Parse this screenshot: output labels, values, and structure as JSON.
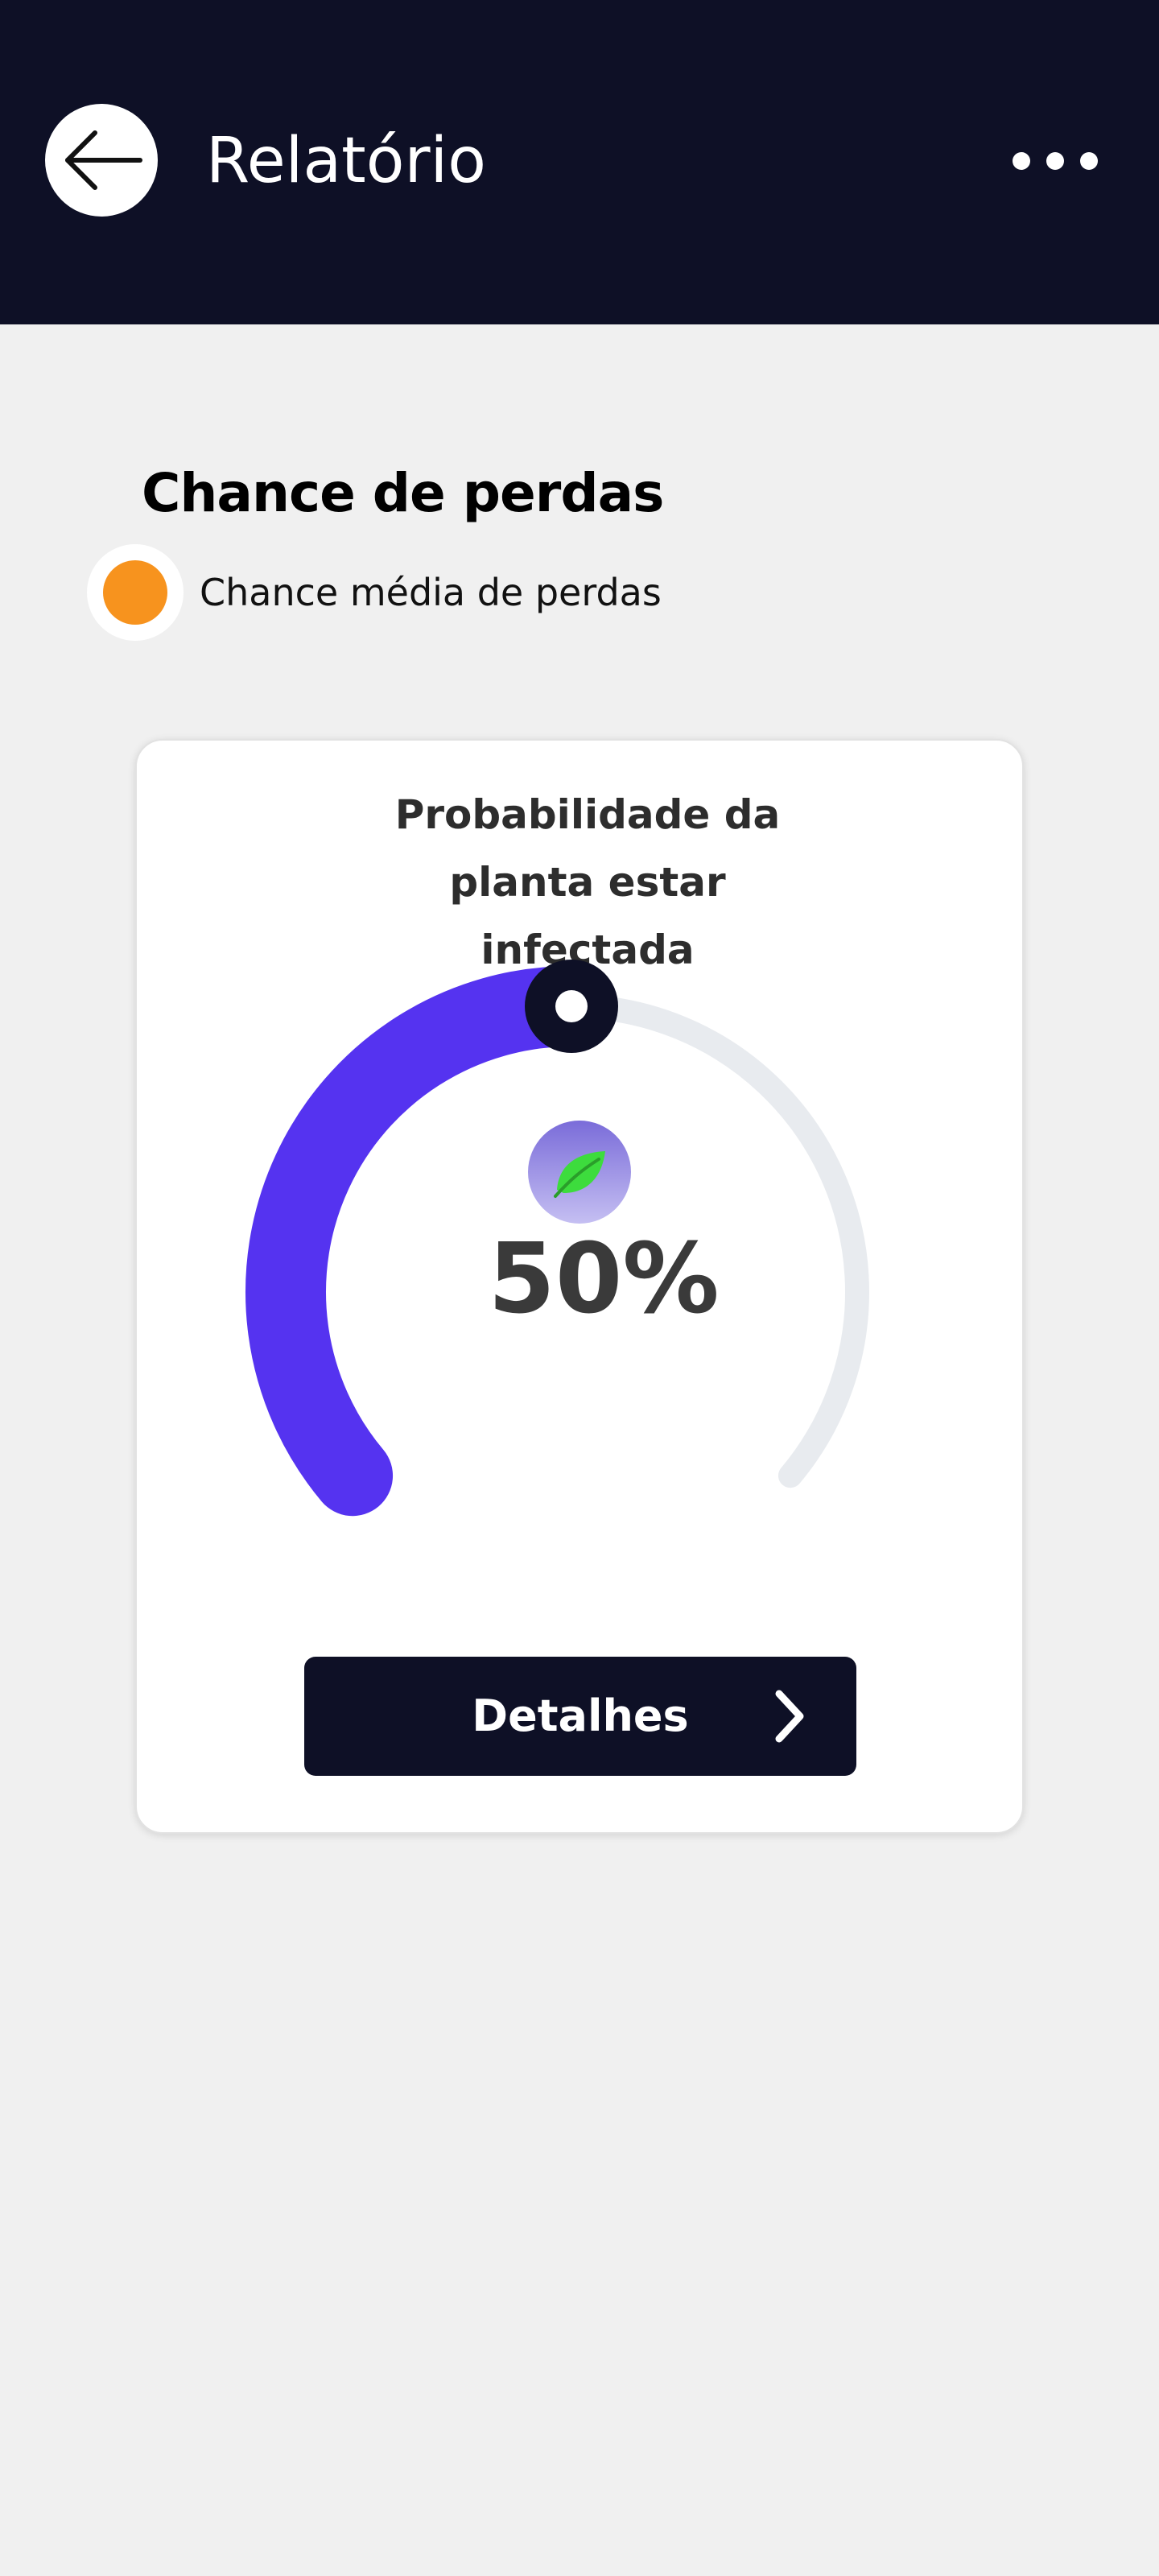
{
  "header": {
    "title": "Relatório",
    "back_icon": "arrow-left-icon",
    "more_icon": "more-horizontal-icon",
    "background_color": "#0e1026"
  },
  "section": {
    "title": "Chance de perdas",
    "legend": {
      "label": "Chance média de perdas",
      "color": "#f7931e"
    }
  },
  "card": {
    "title": "Probabilidade da planta estar infectada",
    "gauge": {
      "value_label": "50%",
      "value_fraction": 0.5,
      "progress_color": "#5533f0",
      "track_color": "#e8ebef",
      "icon": "leaf-icon"
    },
    "button": {
      "label": "Detalhes",
      "icon": "chevron-right-icon"
    }
  }
}
